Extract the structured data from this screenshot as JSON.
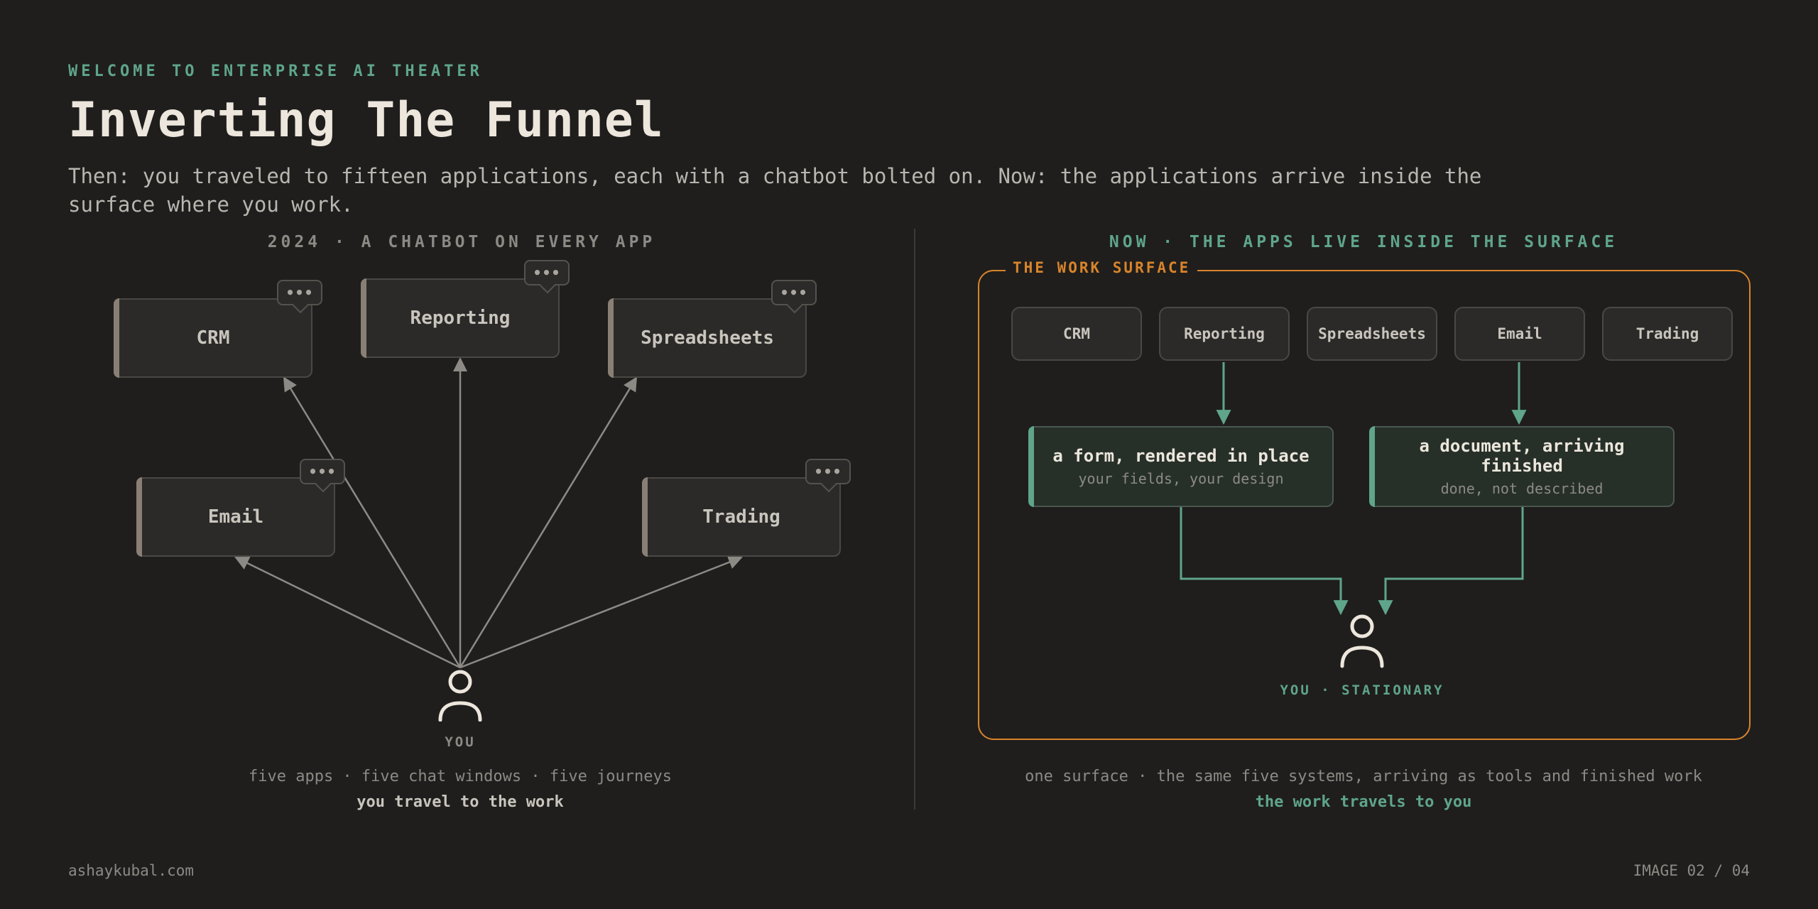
{
  "header": {
    "eyebrow": "WELCOME TO ENTERPRISE AI THEATER",
    "title": "Inverting The Funnel",
    "subtitle": "Then: you traveled to fifteen applications, each with a chatbot bolted on. Now: the applications arrive inside the surface where you work."
  },
  "left": {
    "label": "2024 · A CHATBOT ON EVERY APP",
    "apps": [
      "CRM",
      "Reporting",
      "Spreadsheets",
      "Email",
      "Trading"
    ],
    "bubble": "•••",
    "you": "YOU",
    "caption": "five apps · five chat windows · five journeys",
    "caption_strong": "you travel to the work"
  },
  "right": {
    "label": "NOW · THE APPS LIVE INSIDE THE SURFACE",
    "surface_label": "THE WORK SURFACE",
    "tools": [
      "CRM",
      "Reporting",
      "Spreadsheets",
      "Email",
      "Trading"
    ],
    "cards": [
      {
        "title": "a form, rendered in place",
        "sub": "your fields, your design"
      },
      {
        "title": "a document, arriving finished",
        "sub": "done, not described"
      }
    ],
    "you": "YOU · STATIONARY",
    "caption": "one surface · the same five systems, arriving as tools and finished work",
    "caption_strong": "the work travels to you"
  },
  "footer": {
    "site": "ashaykubal.com",
    "page": "IMAGE 02 / 04"
  },
  "colors": {
    "accent_green": "#5fa58a",
    "accent_orange": "#d9842b",
    "background": "#1f1e1d"
  }
}
